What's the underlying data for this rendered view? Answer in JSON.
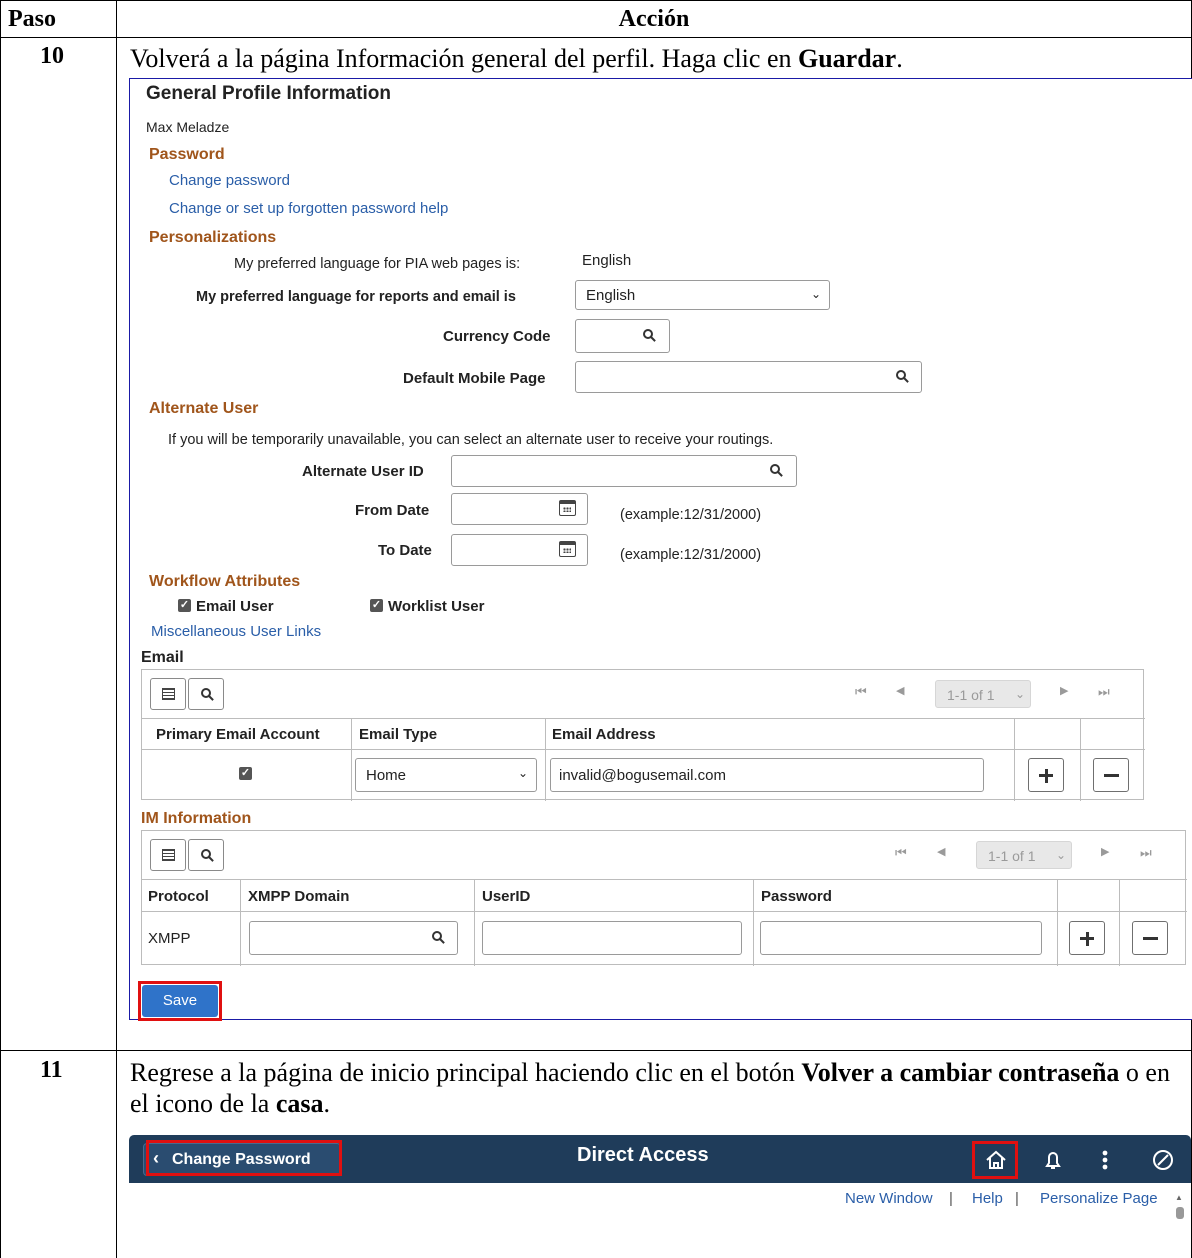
{
  "table": {
    "col_step": "Paso",
    "col_action": "Acción"
  },
  "step10": {
    "number": "10",
    "text_pre": "Volverá a la página Información general del perfil.  Haga clic en ",
    "text_bold": "Guardar",
    "text_post": "."
  },
  "profile": {
    "title": "General Profile Information",
    "user_name": "Max Meladze",
    "password_section": "Password",
    "change_password_link": "Change password",
    "forgot_help_link": "Change or set up forgotten password help",
    "personalizations_section": "Personalizations",
    "pia_language_label": "My preferred language for PIA web pages is:",
    "pia_language_value": "English",
    "report_language_label": "My preferred language for reports and email is",
    "report_language_value": "English",
    "currency_label": "Currency Code",
    "mobile_page_label": "Default Mobile Page",
    "alternate_section": "Alternate User",
    "alternate_note": "If you will be temporarily unavailable, you can select an alternate user to receive your routings.",
    "alt_user_label": "Alternate User ID",
    "from_date_label": "From Date",
    "to_date_label": "To Date",
    "date_example": "(example:12/31/2000)",
    "workflow_section": "Workflow Attributes",
    "email_user_label": "Email User",
    "worklist_user_label": "Worklist User",
    "misc_links": "Miscellaneous User Links",
    "email_section": "Email",
    "pager": "1-1 of 1",
    "email_headers": [
      "Primary Email Account",
      "Email Type",
      "Email Address"
    ],
    "email_type_value": "Home",
    "email_address_value": "invalid@bogusemail.com",
    "im_section": "IM Information",
    "im_headers": [
      "Protocol",
      "XMPP Domain",
      "UserID",
      "Password"
    ],
    "im_protocol_value": "XMPP",
    "save_label": "Save"
  },
  "step11": {
    "number": "11",
    "text_pre": "Regrese a la página de inicio principal haciendo clic  en el botón ",
    "text_bold1": "Volver a cambiar contraseña",
    "text_mid": " o en el icono de la ",
    "text_bold2": "casa",
    "text_post": "."
  },
  "banner": {
    "back_label": "Change Password",
    "title": "Direct Access",
    "link_new_window": "New Window",
    "link_help": "Help",
    "link_personalize": "Personalize Page",
    "sep": "|",
    "bar_color": "#1f3c5a"
  }
}
